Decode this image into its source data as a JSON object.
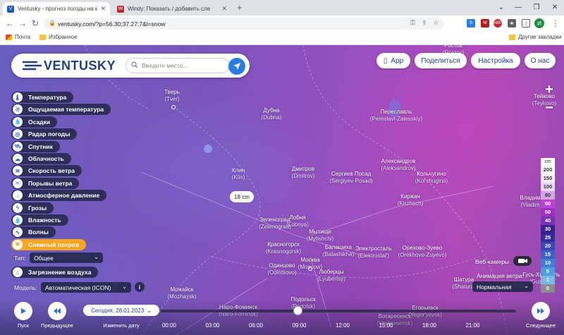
{
  "browser": {
    "tabs": [
      {
        "title": "Ventusky - прогноз погоды на к",
        "active": true,
        "favicon_color": "#1e5bb8",
        "favicon_text": "V"
      },
      {
        "title": "Windy: Показать / добавить сле",
        "active": false,
        "favicon_color": "#c0262d",
        "favicon_text": "W"
      }
    ],
    "new_tab_glyph": "+",
    "url": "ventusky.com/?p=56.30;37.27;7&l=snow",
    "avatar_letter": "И",
    "bookmarks": [
      {
        "label": "Почта",
        "icon": "gmail-icon"
      },
      {
        "label": "Избранное",
        "icon": "folder-icon"
      },
      {
        "label": "Другие закладки",
        "icon": "folder-icon"
      }
    ]
  },
  "header": {
    "logo_text": "VENTUSKY",
    "search_placeholder": "Введите место...",
    "buttons": [
      {
        "label": "App",
        "name": "app-button"
      },
      {
        "label": "Поделиться",
        "name": "share-button"
      },
      {
        "label": "Настройка",
        "name": "settings-button"
      },
      {
        "label": "О нас",
        "name": "about-button"
      }
    ]
  },
  "layers": [
    {
      "label": "Температура",
      "icon": "thermometer-icon",
      "glyph": "🌡"
    },
    {
      "label": "Ощущаемая температура",
      "icon": "feels-like-icon",
      "glyph": "☃"
    },
    {
      "label": "Осадки",
      "icon": "drop-icon",
      "glyph": "💧"
    },
    {
      "label": "Радар погоды",
      "icon": "radar-icon",
      "glyph": "◎"
    },
    {
      "label": "Спутник",
      "icon": "satellite-icon",
      "glyph": "🛰"
    },
    {
      "label": "Облачность",
      "icon": "cloud-icon",
      "glyph": "☁"
    },
    {
      "label": "Скорость ветра",
      "icon": "wind-icon",
      "glyph": "≋"
    },
    {
      "label": "Порывы ветра",
      "icon": "gust-icon",
      "glyph": "≈"
    },
    {
      "label": "Атмосферное давление",
      "icon": "pressure-icon",
      "glyph": "↓"
    },
    {
      "label": "Грозы",
      "icon": "lightning-icon",
      "glyph": "ϟ"
    },
    {
      "label": "Влажность",
      "icon": "humidity-icon",
      "glyph": "💧"
    },
    {
      "label": "Волны",
      "icon": "waves-icon",
      "glyph": "∿"
    },
    {
      "label": "Снежный покров",
      "icon": "snowflake-icon",
      "glyph": "❄",
      "active": true
    }
  ],
  "type_selector": {
    "label": "Тип:",
    "value": "Общее"
  },
  "pollution_layer": {
    "label": "Загрязнение воздуха",
    "icon": "factory-icon",
    "glyph": "⌂"
  },
  "model_selector": {
    "label": "Модель:",
    "value": "Автоматическая (ICON)",
    "info": "i"
  },
  "cities": [
    {
      "name": "Тверь",
      "sub": "(Tver)",
      "dot": true
    },
    {
      "name": "Дубна",
      "sub": "(Dubna)",
      "dot": false
    },
    {
      "name": "Переславль",
      "sub": "(Pereslavl-Zalesskiy)",
      "dot": false
    },
    {
      "name": "Клин",
      "sub": "(Klin)",
      "dot": false
    },
    {
      "name": "Дмитров",
      "sub": "(Dmitrov)",
      "dot": false
    },
    {
      "name": "Сергиев Посад",
      "sub": "(Sergiyev Posad)",
      "dot": false
    },
    {
      "name": "Александров",
      "sub": "(Aleksandrov)",
      "dot": false
    },
    {
      "name": "Кольчугино",
      "sub": "(Kol'chugino)",
      "dot": false
    },
    {
      "name": "Киржач",
      "sub": "(Kirzhach)",
      "dot": false
    },
    {
      "name": "Зеленоград",
      "sub": "(Zelenograd)",
      "dot": false
    },
    {
      "name": "Лобня",
      "sub": "(Lobnya)",
      "dot": false
    },
    {
      "name": "Мытищи",
      "sub": "(Mytishchi)",
      "dot": false
    },
    {
      "name": "Красногорск",
      "sub": "(Krasnogorsk)",
      "dot": false
    },
    {
      "name": "Балашиха",
      "sub": "(Balashikha)",
      "dot": false
    },
    {
      "name": "Электросталь",
      "sub": "(Elektrostal')",
      "dot": false
    },
    {
      "name": "Орехово-Зуево",
      "sub": "(Orekhovo-Zuyevo)",
      "dot": false
    },
    {
      "name": "Москва",
      "sub": "(Moscow)",
      "dot": true
    },
    {
      "name": "Люберцы",
      "sub": "(Lyubertsy)",
      "dot": false
    },
    {
      "name": "Одинцово",
      "sub": "(Odintsovo)",
      "dot": false
    },
    {
      "name": "Можайск",
      "sub": "(Mozhaysk)",
      "dot": false
    },
    {
      "name": "Наро-Фоминск",
      "sub": "(Naro-Fominsk)",
      "dot": false
    },
    {
      "name": "Подольск",
      "sub": "(Podolsk)",
      "dot": false
    },
    {
      "name": "Воскресенск",
      "sub": "(Voskresensk)",
      "dot": false
    },
    {
      "name": "Егорьевск",
      "sub": "(Yegor'yevsk)",
      "dot": false
    },
    {
      "name": "Шатура",
      "sub": "(Shatura)",
      "dot": false
    },
    {
      "name": "Тейково",
      "sub": "(Teykovo)",
      "dot": false
    },
    {
      "name": "Владим",
      "sub": "(Vladim",
      "dot": false
    },
    {
      "name": "Ростов",
      "sub": "(Rostov)",
      "dot": false
    },
    {
      "name": "Гусь-Хрусталь",
      "sub": "(Gus'-Khr",
      "dot": false
    }
  ],
  "value_bubble": "18 cm",
  "zoom": {
    "in": "+",
    "out": "−"
  },
  "legend": {
    "unit": "cm",
    "steps": [
      {
        "value": "200",
        "color": "#ffffff",
        "text": "#333333"
      },
      {
        "value": "150",
        "color": "#f4eef8",
        "text": "#333333"
      },
      {
        "value": "100",
        "color": "#ead8f0",
        "text": "#333333"
      },
      {
        "value": "80",
        "color": "#d3a6e3",
        "text": "#333333"
      },
      {
        "value": "60",
        "color": "#c23fd3",
        "text": "#ffffff"
      },
      {
        "value": "50",
        "color": "#a12fc4",
        "text": "#ffffff"
      },
      {
        "value": "40",
        "color": "#7a33b8",
        "text": "#ffffff"
      },
      {
        "value": "30",
        "color": "#3a1f8e",
        "text": "#ffffff"
      },
      {
        "value": "25",
        "color": "#352c9a",
        "text": "#ffffff"
      },
      {
        "value": "20",
        "color": "#3a47b6",
        "text": "#ffffff"
      },
      {
        "value": "15",
        "color": "#3c61c8",
        "text": "#ffffff"
      },
      {
        "value": "10",
        "color": "#3f7fd4",
        "text": "#ffffff"
      },
      {
        "value": "5",
        "color": "#4d9ee0",
        "text": "#ffffff"
      },
      {
        "value": "1",
        "color": "#7bb8e4",
        "text": "#ffffff"
      },
      {
        "value": "0",
        "color": "#8c8c8c",
        "text": "#ffffff"
      }
    ]
  },
  "webcams": {
    "label": "Веб-камеры"
  },
  "wind_animation": {
    "label": "Анимация ветра:",
    "value": "Нормальная"
  },
  "timeline": {
    "play_label": "Пуск",
    "prev_label": "Предыдущее",
    "change_date_label": "Изменить дату",
    "next_label": "Следующее",
    "date": "Сегодня, 28.01.2023",
    "hours": [
      "00:00",
      "03:00",
      "06:00",
      "09:00",
      "12:00",
      "15:00",
      "18:00",
      "21:00"
    ],
    "current_hour_fraction": 0.385
  }
}
